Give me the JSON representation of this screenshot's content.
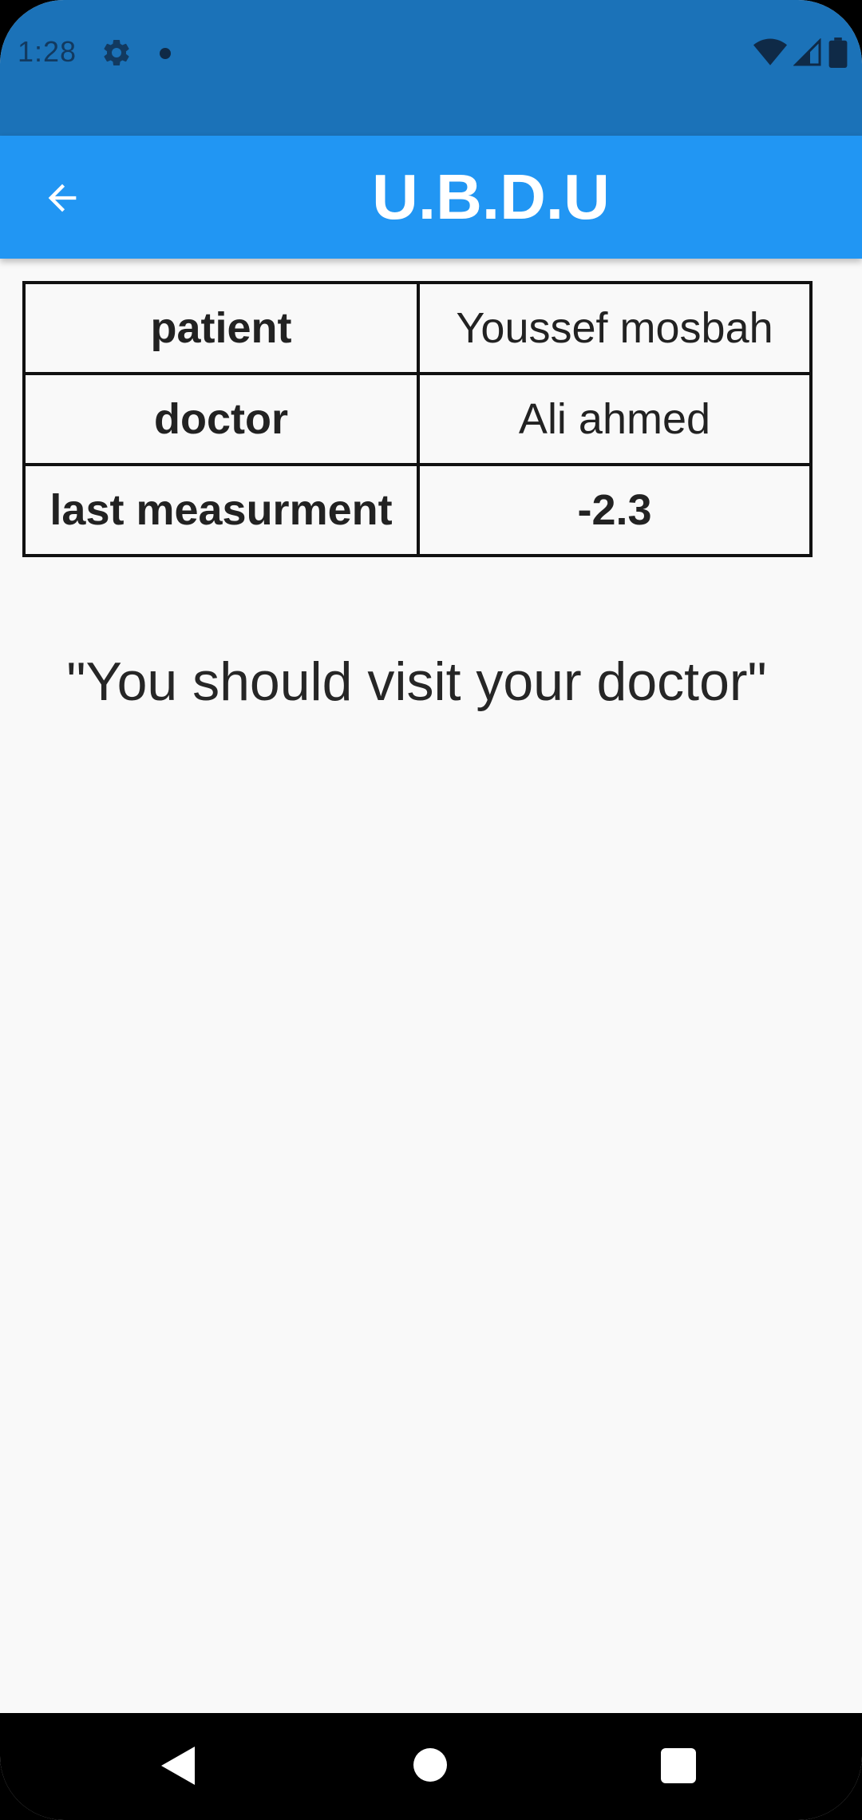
{
  "status_bar": {
    "time": "1:28",
    "icons": [
      "gear-icon",
      "notification-dot-icon",
      "wifi-icon",
      "cellular-signal-icon",
      "battery-icon"
    ]
  },
  "app_bar": {
    "title": "U.B.D.U",
    "back_icon": "arrow-left-icon",
    "color": "#2196f3"
  },
  "table": {
    "rows": [
      {
        "label": "patient",
        "value": "Youssef mosbah"
      },
      {
        "label": "doctor",
        "value": "Ali ahmed"
      },
      {
        "label": "last measurment",
        "value": "-2.3"
      }
    ]
  },
  "message": "\"You should visit your doctor\"",
  "nav_bar": {
    "buttons": [
      "back-icon",
      "home-icon",
      "recents-icon"
    ]
  }
}
